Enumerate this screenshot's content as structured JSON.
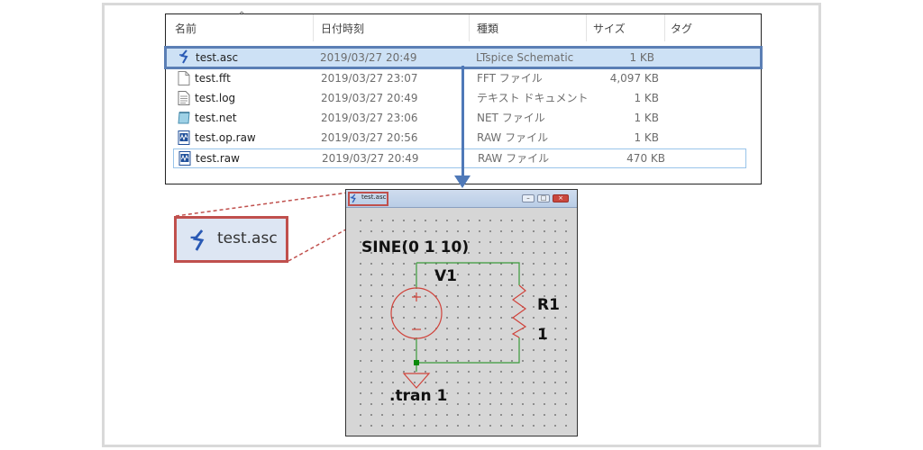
{
  "explorer": {
    "columns": {
      "name": "名前",
      "date": "日付時刻",
      "type": "種類",
      "size": "サイズ",
      "tag": "タグ"
    },
    "files": [
      {
        "name": "test.asc",
        "date": "2019/03/27 20:49",
        "type": "LTspice Schematic",
        "size": "1 KB",
        "icon": "ltspice-icon"
      },
      {
        "name": "test.fft",
        "date": "2019/03/27 23:07",
        "type": "FFT ファイル",
        "size": "4,097 KB",
        "icon": "blank-file-icon"
      },
      {
        "name": "test.log",
        "date": "2019/03/27 20:49",
        "type": "テキスト ドキュメント",
        "size": "1 KB",
        "icon": "text-file-icon"
      },
      {
        "name": "test.net",
        "date": "2019/03/27 23:06",
        "type": "NET ファイル",
        "size": "1 KB",
        "icon": "net-file-icon"
      },
      {
        "name": "test.op.raw",
        "date": "2019/03/27 20:56",
        "type": "RAW ファイル",
        "size": "1 KB",
        "icon": "waveform-file-icon"
      },
      {
        "name": "test.raw",
        "date": "2019/03/27 20:49",
        "type": "RAW ファイル",
        "size": "470 KB",
        "icon": "waveform-file-icon"
      }
    ]
  },
  "ltspice": {
    "window_title": "test.asc",
    "source_value": "SINE(0 1 10)",
    "source_name": "V1",
    "resistor_name": "R1",
    "resistor_value": "1",
    "directive": ".tran 1"
  },
  "zoom": {
    "label": "test.asc"
  },
  "colors": {
    "accent": "#4f79b8",
    "highlight": "#c0504d",
    "wire": "#3a9a3a",
    "component": "#d0433b"
  }
}
